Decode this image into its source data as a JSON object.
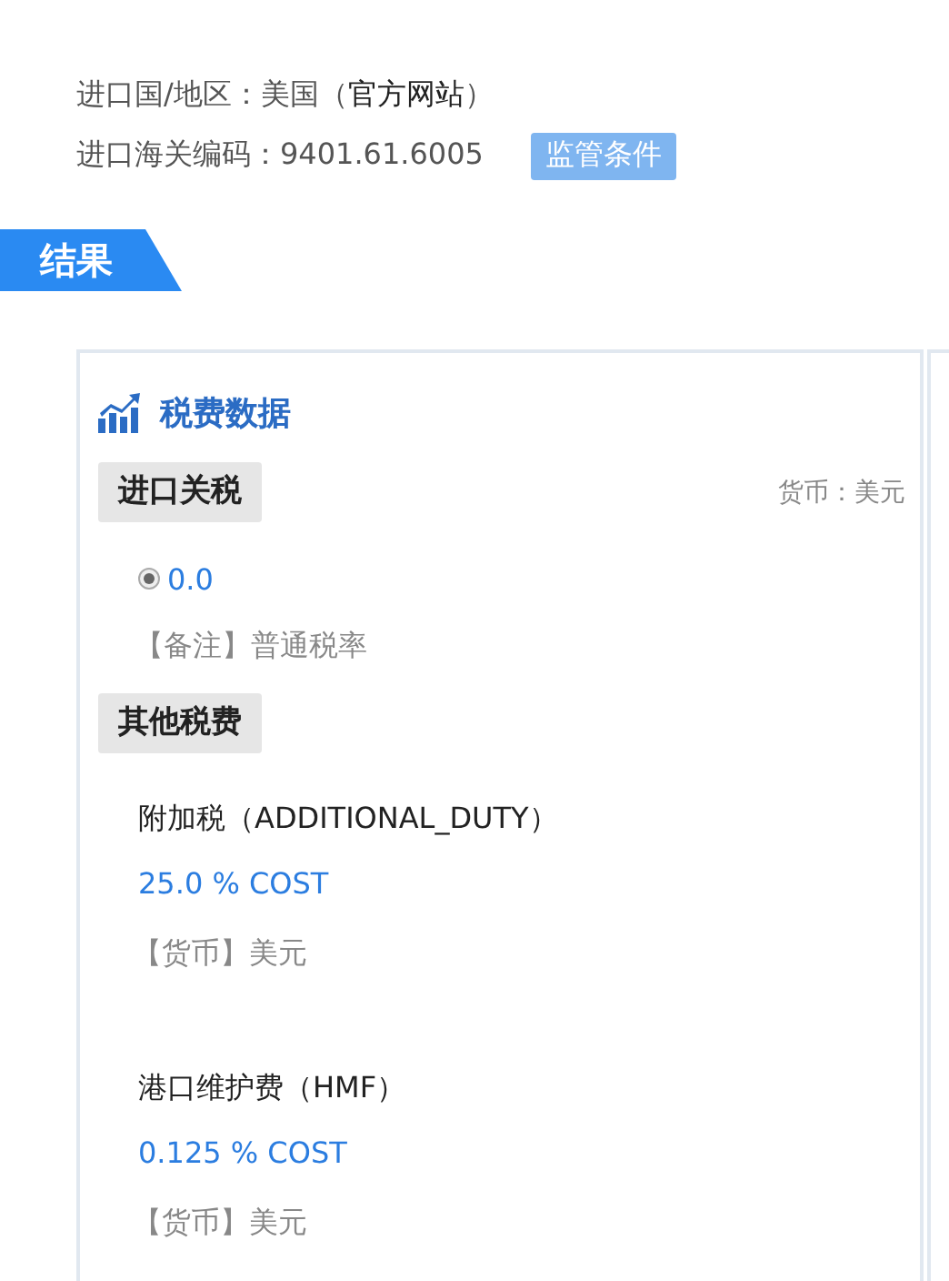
{
  "import_info": {
    "country_before": "进口国/地区：美国（",
    "official_site_link": "官方网站",
    "country_after": "）",
    "hs_code": "进口海关编码：9401.61.6005",
    "regulation_button": "监管条件"
  },
  "result_tab": "结果",
  "tax_panel": {
    "title": "税费数据",
    "sections": [
      {
        "kind": "duty",
        "title": "进口关税",
        "currency": "货币：美元",
        "rates": [
          {
            "value": "0.0",
            "selected": true
          }
        ],
        "note": "【备注】普通税率"
      },
      {
        "kind": "fees",
        "title": "其他税费",
        "fees": [
          {
            "name": "附加税（ADDITIONAL_DUTY）",
            "value": "25.0 % COST",
            "currency": "【货币】美元"
          },
          {
            "name": "港口维护费（HMF）",
            "value": "0.125 % COST",
            "currency": "【货币】美元"
          }
        ]
      }
    ]
  }
}
